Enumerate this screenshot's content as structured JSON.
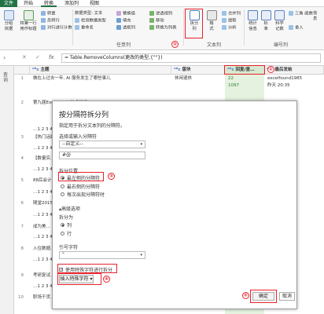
{
  "tabs": [
    "文件",
    "开始",
    "转换",
    "添加列",
    "视图"
  ],
  "ribbon": {
    "g1_b1": "分组\n依据",
    "g1_b2": "将第一行\n用作标题",
    "g1_s1": "转置",
    "g1_s2": "反转行",
    "g1_s3": "对行进行计数",
    "g2_s1": "数据类型: 文本",
    "g2_s2": "检测数据类型",
    "g2_s3": "重命名",
    "g2_s4": "替换值",
    "g2_s5": "填充",
    "g2_s6": "透视列",
    "g2_s7": "逆透视列",
    "g2_s8": "移动",
    "g2_s9": "转换为列表",
    "group2_label": "任意列",
    "split_btn": "拆分\n列",
    "format_btn": "格\n式",
    "g3_s1": "合并列",
    "g3_s2": "提取",
    "g3_s3": "分析",
    "group3_label": "文本列",
    "stat_btn": "统计\n信息",
    "std_btn": "标\n准",
    "sci_btn": "科学\n记数",
    "tri_btn": "三角\n函数",
    "round_btn": "舍入",
    "info_btn": "信\n息",
    "group4_label": "编号列"
  },
  "formula": {
    "text": "= Table.RemoveColumns(更改的类型,{\"\"})",
    "cancel": "✕",
    "commit": "✓",
    "fx": "fx"
  },
  "leftpane_label": "查询",
  "headers": {
    "col1": "主题",
    "col2": "版块",
    "col3": "回复/查…",
    "col4": "最后发帖"
  },
  "rows": [
    {
      "n": "1",
      "c1": "做在上过去一年, AI 服务发生了哪些事儿",
      "c2": "休闲退休",
      "c3a": "22",
      "c3b": "1097",
      "c4a": "excelfound1985",
      "c4b": "昨天 20:35"
    },
    {
      "n": "2",
      "c1": "第九届ExcelHome技术论坛...",
      "c2": "",
      "c3a": "",
      "c3b": "",
      "c4a": "",
      "c4b": ""
    },
    {
      "n": "",
      "c1": "…1 2 3 4",
      "c2": "",
      "c3a": "",
      "c3b": "",
      "c4a": "",
      "c4b": ""
    },
    {
      "n": "3",
      "c1": "【热门话题】...",
      "c2": "",
      "c3a": "",
      "c3b": "",
      "c4a": "",
      "c4b": ""
    },
    {
      "n": "",
      "c1": "…1 2 3 4",
      "c2": "",
      "c3a": "",
      "c3b": "",
      "c4a": "",
      "c4b": ""
    },
    {
      "n": "4",
      "c1": "【数量实...",
      "c2": "",
      "c3a": "",
      "c3b": "",
      "c4a": "",
      "c4b": ""
    },
    {
      "n": "",
      "c1": "…1 2 3 4",
      "c2": "",
      "c3a": "",
      "c3b": "",
      "c4a": "",
      "c4b": ""
    },
    {
      "n": "5",
      "c1": "88后会计...",
      "c2": "",
      "c3a": "",
      "c3b": "",
      "c4a": "",
      "c4b": ""
    },
    {
      "n": "",
      "c1": "…1 2 3 4",
      "c2": "",
      "c3a": "",
      "c3b": "",
      "c4a": "",
      "c4b": ""
    },
    {
      "n": "6",
      "c1": "随堂2015...",
      "c2": "",
      "c3a": "",
      "c3b": "",
      "c4a": "",
      "c4b": ""
    },
    {
      "n": "",
      "c1": "…1 2 3 4",
      "c2": "",
      "c3a": "",
      "c3b": "",
      "c4a": "",
      "c4b": ""
    },
    {
      "n": "7",
      "c1": "成为美...",
      "c2": "",
      "c3a": "",
      "c3b": "",
      "c4a": "",
      "c4b": ""
    },
    {
      "n": "",
      "c1": "…1 2 3 4",
      "c2": "",
      "c3a": "",
      "c3b": "",
      "c4a": "",
      "c4b": ""
    },
    {
      "n": "8",
      "c1": "入住数据...",
      "c2": "",
      "c3a": "",
      "c3b": "",
      "c4a": "",
      "c4b": ""
    },
    {
      "n": "",
      "c1": "…1 2 3 4",
      "c2": "",
      "c3a": "",
      "c3b": "",
      "c4a": "",
      "c4b": ""
    },
    {
      "n": "9",
      "c1": "考研复试...",
      "c2": "",
      "c3a": "",
      "c3b": "",
      "c4a": "",
      "c4b": ""
    },
    {
      "n": "",
      "c1": "…1 2 3 4",
      "c2": "",
      "c3a": "",
      "c3b": "",
      "c4a": "",
      "c4b": ""
    },
    {
      "n": "10",
      "c1": "职场干货...",
      "c2": "",
      "c3a": "",
      "c3b": "",
      "c4a": "",
      "c4b": ""
    }
  ],
  "dialog": {
    "title": "按分隔符拆分列",
    "subtitle": "指定用于拆分文本列的分隔符。",
    "sep_label": "选择或输入分隔符",
    "sep_value": "--自定义--",
    "custom_value": "#@",
    "split_at_label": "拆分位置",
    "opt1": "最左侧的分隔符",
    "opt2": "最右侧的分隔符",
    "opt3": "每次出现分隔符时",
    "advanced": "▴高级选项",
    "split_into": "拆分为",
    "col_opt": "列",
    "row_opt": "行",
    "quote_label": "引号字符",
    "quote_value": "\"",
    "special_chk": "使用特殊字符进行拆分",
    "insert_special": "插入特殊字符 ▾",
    "ok": "确定",
    "cancel": "取消"
  },
  "markers": {
    "m1": "①",
    "m2": "②",
    "m3": "③",
    "m4": "④",
    "m5": "⑤"
  }
}
